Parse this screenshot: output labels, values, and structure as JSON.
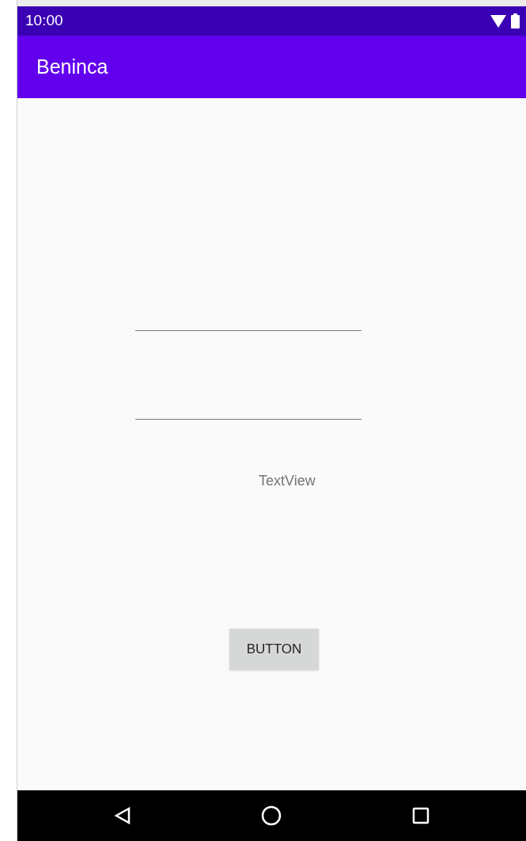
{
  "status_bar": {
    "time": "10:00"
  },
  "app_bar": {
    "title": "Beninca"
  },
  "fields": [
    {
      "kind": "text"
    },
    {
      "kind": "text"
    }
  ],
  "text_view": "TextView",
  "button": "BUTTON"
}
